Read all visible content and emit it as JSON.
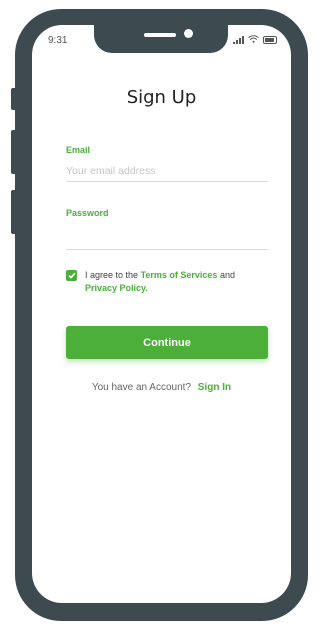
{
  "status_bar": {
    "time": "9:31"
  },
  "page": {
    "title": "Sign Up"
  },
  "form": {
    "email_label": "Email",
    "email_placeholder": "Your email address",
    "email_value": "",
    "password_label": "Password",
    "password_value": ""
  },
  "agreement": {
    "checked": true,
    "text_before": "I agree to the",
    "terms_link": "Terms of Services",
    "text_middle": "and",
    "privacy_link": "Privacy Policy."
  },
  "continue_button": {
    "label": "Continue"
  },
  "footer": {
    "prompt": "You have an Account?",
    "signin_link": "Sign In"
  },
  "colors": {
    "accent": "#4caf3a",
    "phone_frame": "#3d4a50"
  },
  "icons": {
    "signal": "signal-icon",
    "wifi": "wifi-icon",
    "battery": "battery-icon",
    "check": "check-icon"
  }
}
